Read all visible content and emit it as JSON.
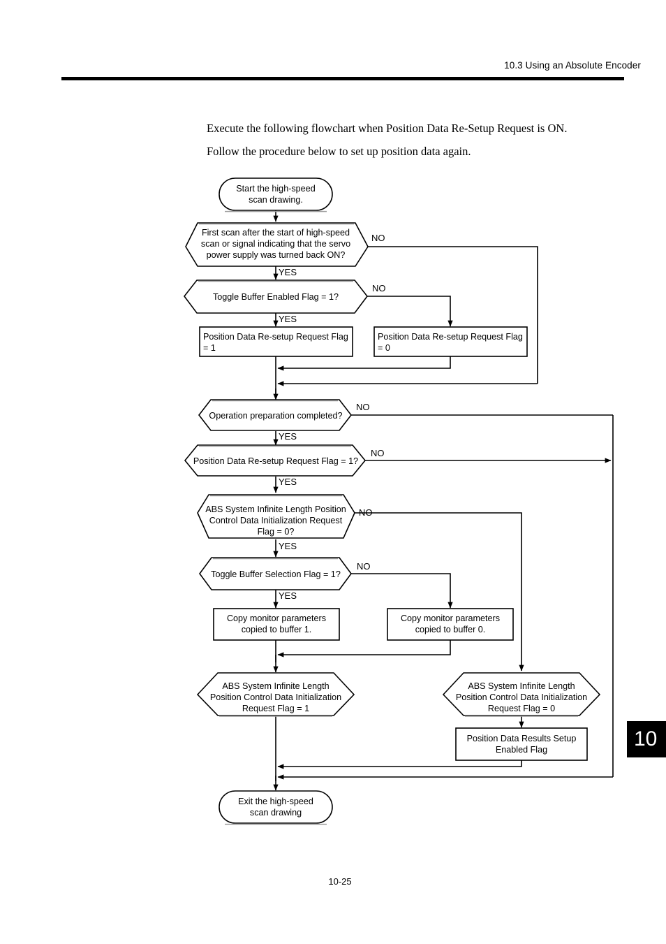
{
  "header": {
    "section_title": "10.3  Using an Absolute Encoder",
    "chapter_tab": "10"
  },
  "body": {
    "paragraph_1": "Execute the following flowchart when Position Data Re-Setup Request is ON.",
    "paragraph_2": "Follow the procedure below to set up position data again."
  },
  "footer": {
    "page_number": "10-25"
  },
  "flowchart": {
    "nodes": {
      "start": {
        "type": "terminator",
        "line_1": "Start the high-speed",
        "line_2": "scan drawing."
      },
      "decision_first_scan": {
        "type": "decision",
        "line_1": "First scan after the start of high-speed",
        "line_2": "scan or signal indicating that the servo",
        "line_3": "power supply was turned back ON?"
      },
      "decision_toggle_enabled": {
        "type": "decision",
        "line_1": "Toggle Buffer Enabled Flag = 1?"
      },
      "process_resetup_flag_1": {
        "type": "process",
        "line_1": "Position Data Re-setup Request Flag",
        "line_2": "= 1"
      },
      "process_resetup_flag_0": {
        "type": "process",
        "line_1": "Position Data Re-setup Request Flag",
        "line_2": "= 0"
      },
      "decision_operation_prep": {
        "type": "decision",
        "line_1": "Operation preparation completed?"
      },
      "decision_resetup_request": {
        "type": "decision",
        "line_1": "Position Data Re-setup Request Flag = 1?"
      },
      "decision_abs_init_flag_0": {
        "type": "decision",
        "line_1": "ABS System Infinite Length Position",
        "line_2": "Control Data Initialization Request",
        "line_3": "Flag = 0?"
      },
      "decision_toggle_selection": {
        "type": "decision",
        "line_1": "Toggle Buffer Selection Flag = 1?"
      },
      "process_copy_buffer_1": {
        "type": "process",
        "line_1": "Copy monitor parameters",
        "line_2": "copied to buffer 1."
      },
      "process_copy_buffer_0": {
        "type": "process",
        "line_1": "Copy monitor parameters",
        "line_2": "copied to buffer 0."
      },
      "hex_abs_request_flag_1": {
        "type": "hexagon",
        "line_1": "ABS System Infinite Length",
        "line_2": "Position Control Data Initialization",
        "line_3": "Request Flag = 1"
      },
      "hex_abs_request_flag_0": {
        "type": "hexagon",
        "line_1": "ABS System Infinite Length",
        "line_2": "Position Control Data Initialization",
        "line_3": "Request Flag = 0"
      },
      "process_results_setup": {
        "type": "process",
        "line_1": "Position Data Results Setup",
        "line_2": "Enabled Flag"
      },
      "exit": {
        "type": "terminator",
        "line_1": "Exit the high-speed",
        "line_2": "scan drawing"
      }
    },
    "branch_labels": {
      "no_first_scan": "NO",
      "yes_first_scan": "YES",
      "no_toggle_enabled": "NO",
      "yes_toggle_enabled": "YES",
      "no_operation_prep": "NO",
      "yes_operation_prep": "YES",
      "no_resetup_request": "NO",
      "yes_resetup_request": "YES",
      "no_abs_init": "NO",
      "yes_abs_init": "YES",
      "no_toggle_selection": "NO",
      "yes_toggle_selection": "YES"
    }
  }
}
